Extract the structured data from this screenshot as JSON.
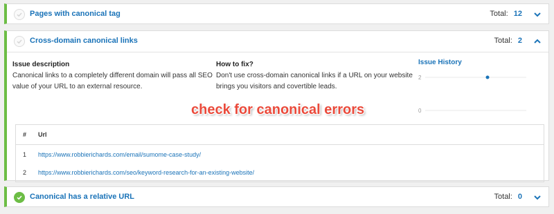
{
  "panels": [
    {
      "title": "Pages with canonical tag",
      "total_label": "Total:",
      "total_value": "12",
      "status": "muted",
      "status_icon": "check-circle-icon"
    },
    {
      "title": "Cross-domain canonical links",
      "total_label": "Total:",
      "total_value": "2",
      "status": "muted",
      "status_icon": "check-circle-icon",
      "expanded": true,
      "issue_description_heading": "Issue description",
      "issue_description_text_1": "Canonical links to a completely different domain will pass all SEO",
      "issue_description_text_2": "value of your URL to an external resource.",
      "how_to_fix_heading": "How to fix?",
      "how_to_fix_text_1": "Don't use cross-domain canonical links if a URL on your website",
      "how_to_fix_text_2": "brings you visitors and covertible leads.",
      "issue_history_title": "Issue History",
      "issue_history": {
        "y_labels": [
          "2",
          "0"
        ],
        "ylim": [
          0,
          2
        ],
        "points": [
          2
        ]
      },
      "overlay_text": "check for canonical errors",
      "table": {
        "headers": [
          "#",
          "Url"
        ],
        "rows": [
          {
            "num": "1",
            "url": "https://www.robbierichards.com/email/sumome-case-study/"
          },
          {
            "num": "2",
            "url": "https://www.robbierichards.com/seo/keyword-research-for-an-existing-website/"
          }
        ]
      }
    },
    {
      "title": "Canonical has a relative URL",
      "total_label": "Total:",
      "total_value": "0",
      "status": "ok",
      "status_icon": "check-circle-icon"
    }
  ],
  "colors": {
    "accent": "#1a73b8",
    "success": "#6cbd45",
    "overlay": "#ea4a3b"
  }
}
